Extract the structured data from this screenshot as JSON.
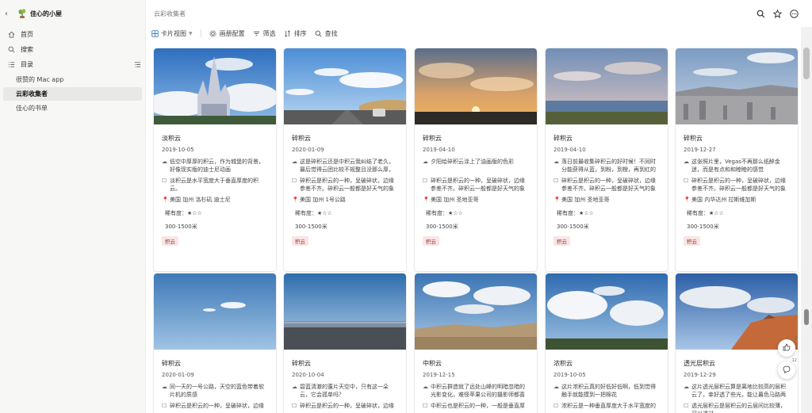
{
  "workspace": {
    "name": "佳心的小屋"
  },
  "sidebar": {
    "items": [
      {
        "label": "首页",
        "icon": "home-icon"
      },
      {
        "label": "搜索",
        "icon": "search-icon"
      },
      {
        "label": "目录",
        "icon": "list-icon"
      }
    ],
    "pages": [
      {
        "label": "很赞的 Mac app",
        "active": false
      },
      {
        "label": "云彩收集者",
        "active": true
      },
      {
        "label": "佳心的书单",
        "active": false
      }
    ]
  },
  "header": {
    "title": "云彩收集者"
  },
  "toolbar": {
    "view_label": "卡片视图",
    "gallery_settings": "画册配置",
    "filter": "筛选",
    "sort": "排序",
    "search": "查找"
  },
  "cards": [
    {
      "name": "淡积云",
      "date": "2019-10-05",
      "desc": "低空中厚厚的积云，作为城堡的背景，好像现实版的迪士尼动画",
      "feature": "淡积云是水平宽度大于垂直厚度的积云。",
      "place": "美国 加州 洛杉矶 迪士尼",
      "rarity_label": "稀有度：",
      "rarity": "★☆☆",
      "height": "300-1500米",
      "tag": "积云"
    },
    {
      "name": "碎积云",
      "date": "2020-01-09",
      "desc": "这是碎积云还是中积云我纠结了老久，最后觉得云团比较不规整且没那么厚，还…",
      "feature": "碎积云是积云的一种，呈破碎状，边缘参差不齐。碎积云一般都是好天气的象征…",
      "place": "美国 加州 1号公路",
      "rarity_label": "稀有度：",
      "rarity": "★☆☆",
      "height": "300-1500米",
      "tag": "积云"
    },
    {
      "name": "碎积云",
      "date": "2019-04-10",
      "desc": "夕阳给碎积云涂上了油画版的色彩",
      "feature": "碎积云是积云的一种，呈破碎状，边缘参差不齐。碎积云一般都是好天气的象征…",
      "place": "美国 加州 圣地亚哥",
      "rarity_label": "稀有度：",
      "rarity": "★☆☆",
      "height": "300-1500米",
      "tag": "积云"
    },
    {
      "name": "碎积云",
      "date": "2019-04-10",
      "desc": "落日前最收集碎积云的好时候！不同时分能获得从蓝，到粉，到橙，再到红的背…",
      "feature": "碎积云是积云的一种，呈破碎状，边缘参差不齐。碎积云一般都是好天气的象征…",
      "place": "美国 加州 圣地亚哥",
      "rarity_label": "稀有度：",
      "rarity": "★☆☆",
      "height": "300-1500米",
      "tag": "积云"
    },
    {
      "name": "碎积云",
      "date": "2019-12-27",
      "desc": "这张照片里，Vegas不再那么纸醉金迷，而是有点和和睦睦的感觉",
      "feature": "碎积云是积云的一种，呈破碎状，边缘参差不齐。碎积云一般都是好天气的象征…",
      "place": "美国 内华达州 拉斯维加斯",
      "rarity_label": "稀有度：",
      "rarity": "★☆☆",
      "height": "300-1500米",
      "tag": "积云"
    },
    {
      "name": "碎积云",
      "date": "2020-01-09",
      "desc": "同一天的一号公路，天空的蓝色带着软片机的质感",
      "feature": "碎积云是积云的一种，呈破碎状，边缘"
    },
    {
      "name": "碎积云",
      "date": "2020-10-04",
      "desc": "碧蓝清澈的蓬片天空中，只有这一朵云，它会孤单吗？",
      "feature": "碎积云是积云的一种，呈破碎状，边缘"
    },
    {
      "name": "中积云",
      "date": "2019-12-15",
      "desc": "中积云群造就了远处山峰的明暗忽暗的光影变化，难怪苹果公司的摄影师都喜欢…",
      "feature": "中积云也是积云的一种，一般是垂直厚"
    },
    {
      "name": "浓积云",
      "date": "2019-10-05",
      "desc": "这片浓积云真的好低好低啊，低到觉得触手就能摸到一把棉花",
      "feature": "浓积云是一种垂直厚度大于水平宽度的"
    },
    {
      "name": "透光层积云",
      "date": "2019-12-29",
      "desc": "这片透光层积云算是离地比较高的层积云了，幸好透了些光，能让暮色马路两侧…",
      "feature": "透光层积云是层积云的云层间比较薄，可以透过"
    }
  ],
  "floating": {
    "like_count": "3",
    "comment_count": "12"
  },
  "colors": {
    "tag_bg": "#fbe4e4",
    "tag_text": "#8a3a3a",
    "sidebar_bg": "#f7f7f5"
  }
}
